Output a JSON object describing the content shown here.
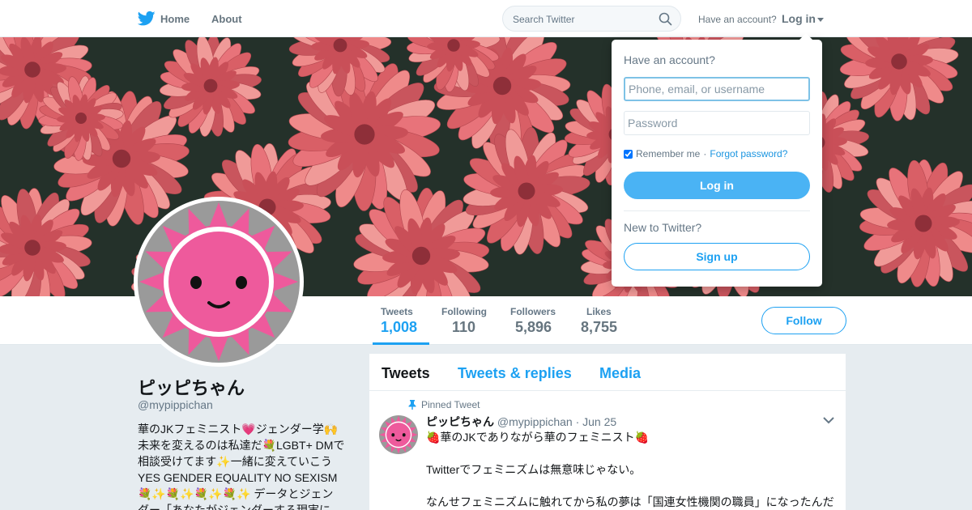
{
  "colors": {
    "accent": "#1da1f2",
    "avatar_pink": "#ee5a9c",
    "banner_flower": "#e06a6a"
  },
  "nav": {
    "home_label": "Home",
    "about_label": "About",
    "search_placeholder": "Search Twitter",
    "have_account": "Have an account?",
    "login_label": "Log in",
    "icons": [
      "twitter-bird-icon",
      "search-icon",
      "caret-down-icon"
    ]
  },
  "stats": [
    {
      "label": "Tweets",
      "value": "1,008"
    },
    {
      "label": "Following",
      "value": "110"
    },
    {
      "label": "Followers",
      "value": "5,896"
    },
    {
      "label": "Likes",
      "value": "8,755"
    }
  ],
  "follow_label": "Follow",
  "profile": {
    "name": "ピッピちゃん",
    "handle": "@mypippichan",
    "bio": "華のJKフェミニスト💗ジェンダー学🙌\n未来を変えるのは私達だ💐LGBT+ DMで\n相談受けてます✨一緒に変えていこう\nYES GENDER EQUALITY NO SEXISM\n💐✨💐✨💐✨💐✨ データとジェン\nダー「あなたがジェンダーする現実に"
  },
  "tabs": [
    "Tweets",
    "Tweets & replies",
    "Media"
  ],
  "tweet": {
    "pinned_label": "Pinned Tweet",
    "name": "ピッピちゃん",
    "handle": "@mypippichan",
    "date": "· Jun 25",
    "body": "🍓華のJKでありながら華のフェミニスト🍓\n\nTwitterでフェミニズムは無意味じゃない。\n\nなんせフェミニズムに触れてから私の夢は「国連女性機関の職員」になったんだ"
  },
  "login_dropdown": {
    "title": "Have an account?",
    "username_placeholder": "Phone, email, or username",
    "password_placeholder": "Password",
    "remember_me": "Remember me",
    "separator": "·",
    "forgot_password": "Forgot password?",
    "login_button": "Log in",
    "new_to_twitter": "New to Twitter?",
    "signup_button": "Sign up"
  }
}
